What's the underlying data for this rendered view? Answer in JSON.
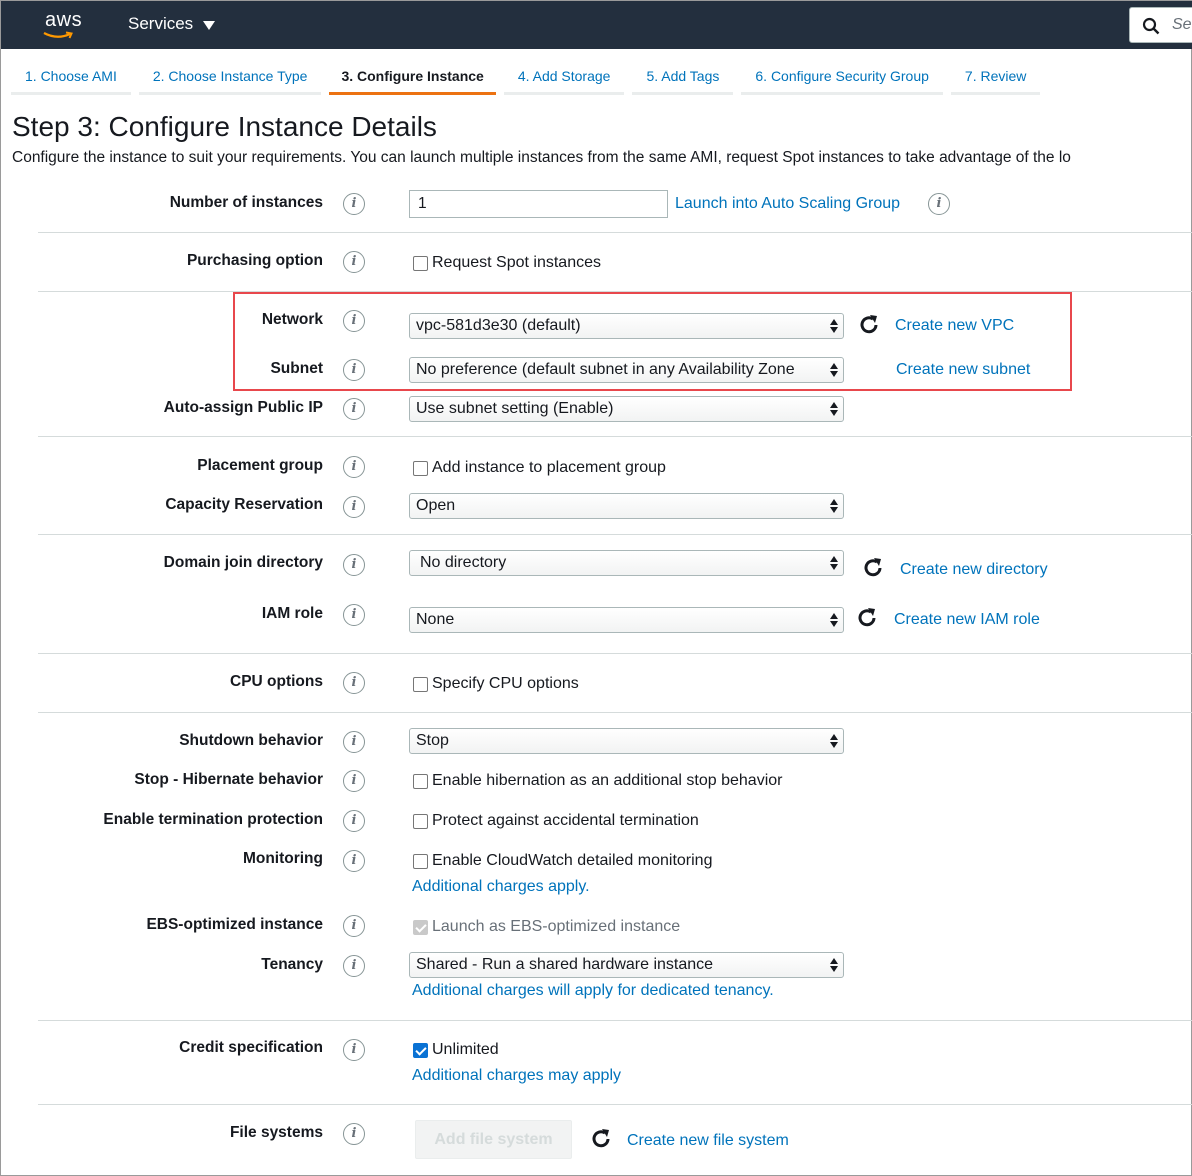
{
  "topnav": {
    "logo_text": "aws",
    "services_label": "Services",
    "search_placeholder": "Se"
  },
  "tabs": [
    {
      "label": "1. Choose AMI",
      "active": false
    },
    {
      "label": "2. Choose Instance Type",
      "active": false
    },
    {
      "label": "3. Configure Instance",
      "active": true
    },
    {
      "label": "4. Add Storage",
      "active": false
    },
    {
      "label": "5. Add Tags",
      "active": false
    },
    {
      "label": "6. Configure Security Group",
      "active": false
    },
    {
      "label": "7. Review",
      "active": false
    }
  ],
  "page": {
    "title": "Step 3: Configure Instance Details",
    "description": "Configure the instance to suit your requirements. You can launch multiple instances from the same AMI, request Spot instances to take advantage of the lo"
  },
  "form": {
    "number_of_instances": {
      "label": "Number of instances",
      "value": "1",
      "link": "Launch into Auto Scaling Group"
    },
    "purchasing_option": {
      "label": "Purchasing option",
      "checkbox": "Request Spot instances",
      "checked": false
    },
    "network": {
      "label": "Network",
      "value": "vpc-581d3e30 (default)",
      "link": "Create new VPC"
    },
    "subnet": {
      "label": "Subnet",
      "value": "No preference (default subnet in any Availability Zone",
      "link": "Create new subnet"
    },
    "auto_assign_ip": {
      "label": "Auto-assign Public IP",
      "value": "Use subnet setting (Enable)"
    },
    "placement_group": {
      "label": "Placement group",
      "checkbox": "Add instance to placement group",
      "checked": false
    },
    "capacity_reservation": {
      "label": "Capacity Reservation",
      "value": "Open"
    },
    "domain_join": {
      "label": "Domain join directory",
      "value": "No directory",
      "link": "Create new directory"
    },
    "iam_role": {
      "label": "IAM role",
      "value": "None",
      "link": "Create new IAM role"
    },
    "cpu_options": {
      "label": "CPU options",
      "checkbox": "Specify CPU options",
      "checked": false
    },
    "shutdown_behavior": {
      "label": "Shutdown behavior",
      "value": "Stop"
    },
    "hibernate": {
      "label": "Stop - Hibernate behavior",
      "checkbox": "Enable hibernation as an additional stop behavior",
      "checked": false
    },
    "termination_protection": {
      "label": "Enable termination protection",
      "checkbox": "Protect against accidental termination",
      "checked": false
    },
    "monitoring": {
      "label": "Monitoring",
      "checkbox": "Enable CloudWatch detailed monitoring",
      "checked": false,
      "note": "Additional charges apply."
    },
    "ebs_optimized": {
      "label": "EBS-optimized instance",
      "checkbox": "Launch as EBS-optimized instance",
      "checked": true,
      "disabled": true
    },
    "tenancy": {
      "label": "Tenancy",
      "value": "Shared - Run a shared hardware instance",
      "note": "Additional charges will apply for dedicated tenancy."
    },
    "credit_specification": {
      "label": "Credit specification",
      "checkbox": "Unlimited",
      "checked": true,
      "note": "Additional charges may apply"
    },
    "file_systems": {
      "label": "File systems",
      "button": "Add file system",
      "link": "Create new file system"
    }
  },
  "colors": {
    "nav_bg": "#232f3e",
    "link": "#0073bb",
    "active_tab_border": "#ec7211",
    "highlight_box": "#e8474c"
  }
}
